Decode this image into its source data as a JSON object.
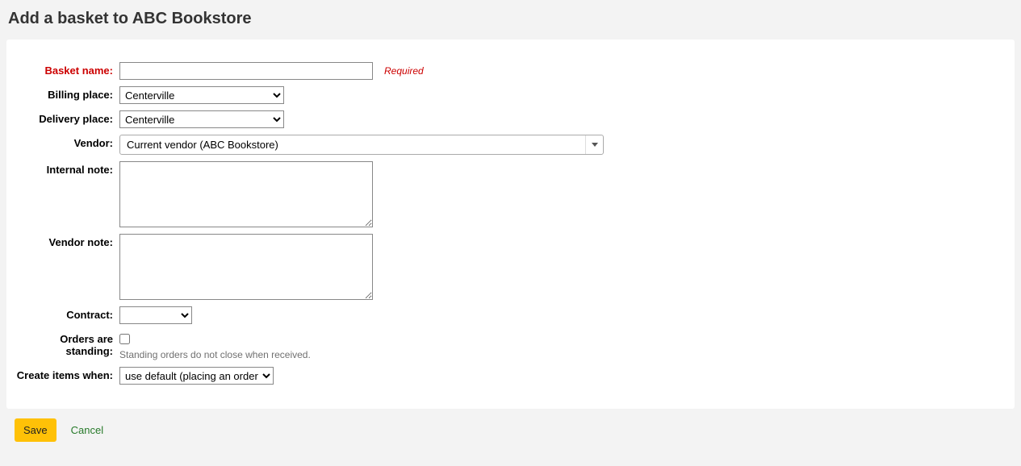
{
  "heading": "Add a basket to ABC Bookstore",
  "labels": {
    "basket_name": "Basket name:",
    "billing_place": "Billing place:",
    "delivery_place": "Delivery place:",
    "vendor": "Vendor:",
    "internal_note": "Internal note:",
    "vendor_note": "Vendor note:",
    "contract": "Contract:",
    "orders_standing": "Orders are standing:",
    "create_items": "Create items when:"
  },
  "values": {
    "basket_name": "",
    "billing_place": "Centerville",
    "delivery_place": "Centerville",
    "vendor": "Current vendor (ABC Bookstore)",
    "internal_note": "",
    "vendor_note": "",
    "contract": "",
    "orders_standing": false,
    "create_items": "use default (placing an order)"
  },
  "hints": {
    "required": "Required",
    "standing": "Standing orders do not close when received."
  },
  "buttons": {
    "save": "Save",
    "cancel": "Cancel"
  }
}
